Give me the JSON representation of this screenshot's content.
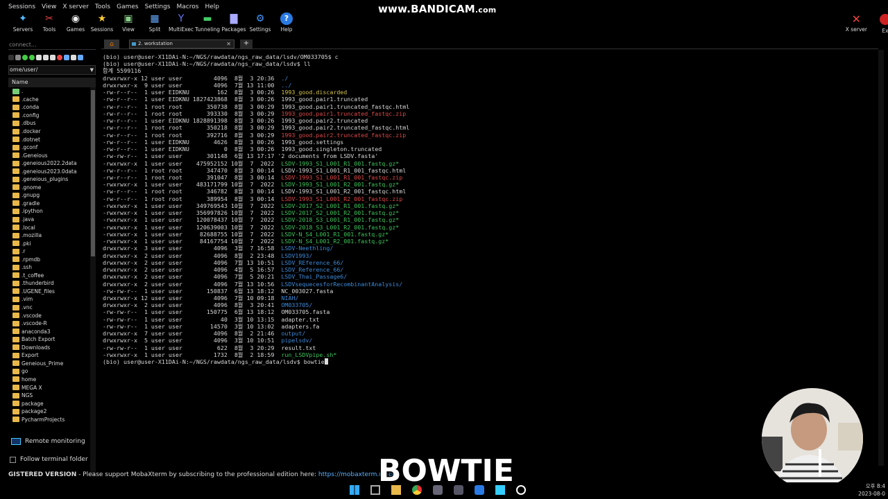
{
  "menu": [
    "Sessions",
    "View",
    "X server",
    "Tools",
    "Games",
    "Settings",
    "Macros",
    "Help"
  ],
  "toolbar": [
    {
      "label": "Servers",
      "icon": "servers-icon"
    },
    {
      "label": "Tools",
      "icon": "tools-icon"
    },
    {
      "label": "Games",
      "icon": "games-icon"
    },
    {
      "label": "Sessions",
      "icon": "sessions-icon"
    },
    {
      "label": "View",
      "icon": "view-icon"
    },
    {
      "label": "Split",
      "icon": "split-icon"
    },
    {
      "label": "MultiExec",
      "icon": "multiexec-icon"
    },
    {
      "label": "Tunneling",
      "icon": "tunneling-icon"
    },
    {
      "label": "Packages",
      "icon": "packages-icon"
    },
    {
      "label": "Settings",
      "icon": "settings-icon"
    },
    {
      "label": "Help",
      "icon": "help-icon"
    }
  ],
  "toolbar_right": {
    "xserver": "X server",
    "exit": "Ex"
  },
  "watermark": {
    "main": "www.BANDICAM",
    "suffix": ".com"
  },
  "sidebar": {
    "search_placeholder": "connect...",
    "path": "ome/user/",
    "header": "Name",
    "items": [
      ".",
      ".cache",
      ".conda",
      ".config",
      ".dbus",
      ".docker",
      ".dotnet",
      ".gconf",
      ".Geneious",
      ".geneious2022.2data",
      ".geneious2023.0data",
      ".geneious_plugins",
      ".gnome",
      ".gnupg",
      ".gradle",
      ".ipython",
      ".java",
      ".local",
      ".mozilla",
      ".pki",
      ".r",
      ".rpmdb",
      ".ssh",
      ".t_coffee",
      ".thunderbird",
      ".UGENE_files",
      ".vim",
      ".vnc",
      ".vscode",
      ".vscode-R",
      "anaconda3",
      "Batch Export",
      "Downloads",
      "Export",
      "Geneious_Prime",
      "go",
      "home",
      "MEGA X",
      "NGS",
      "package",
      "package2",
      "PycharmProjects"
    ],
    "remote_monitoring": "Remote monitoring",
    "follow_folder": "Follow terminal folder"
  },
  "tabs": {
    "active": "2. workstation"
  },
  "terminal": {
    "lines": [
      {
        "t": "(bio) user@user-X11DAi-N:~/NGS/rawdata/ngs_raw_data/lsdv/OM033705$ c",
        "c": ""
      },
      {
        "t": "(bio) user@user-X11DAi-N:~/NGS/rawdata/ngs_raw_data/lsdv$ ll",
        "c": ""
      },
      {
        "t": "합계 5599116",
        "c": ""
      },
      {
        "p": "drwxrwxr-x 12 user user         4096  8월  3 20:36  ",
        "n": "./",
        "c": "c-blue"
      },
      {
        "p": "drwxrwxr-x  9 user user         4096  7월 13 11:00  ",
        "n": "../",
        "c": "c-blue"
      },
      {
        "p": "-rw-r--r--  1 user EIDKNU        162  8월  3 00:26  ",
        "n": "1993_good.discarded",
        "c": "",
        "hl": ".discarded"
      },
      {
        "p": "-rw-r--r--  1 user EIDKNU 1827423868  8월  3 00:26  ",
        "n": "1993_good.pair1.truncated",
        "c": ""
      },
      {
        "p": "-rw-r--r--  1 root root       350738  8월  3 00:29  ",
        "n": "1993_good.pair1.truncated_fastqc.html",
        "c": ""
      },
      {
        "p": "-rw-r--r--  1 root root       393330  8월  3 00:29  ",
        "n": "1993_good.pair1.truncated_fastqc.zip",
        "c": "c-red"
      },
      {
        "p": "-rw-r--r--  1 user EIDKNU 1828891398  8월  3 00:26  ",
        "n": "1993_good.pair2.truncated",
        "c": ""
      },
      {
        "p": "-rw-r--r--  1 root root       350218  8월  3 00:29  ",
        "n": "1993_good.pair2.truncated_fastqc.html",
        "c": ""
      },
      {
        "p": "-rw-r--r--  1 root root       392716  8월  3 00:29  ",
        "n": "1993_good.pair2.truncated_fastqc.zip",
        "c": "c-red"
      },
      {
        "p": "-rw-r--r--  1 user EIDKNU       4626  8월  3 00:26  ",
        "n": "1993_good.settings",
        "c": ""
      },
      {
        "p": "-rw-r--r--  1 user EIDKNU          0  8월  3 00:26  ",
        "n": "1993_good.singleton.truncated",
        "c": ""
      },
      {
        "p": "-rw-rw-r--  1 user user       301148  6월 13 17:17 ",
        "n": "'2 documents from LSDV.fasta'",
        "c": ""
      },
      {
        "p": "-rwxrwxr-x  1 user user    475952152 10월  7  2022  ",
        "n": "LSDV-1993_S1_L001_R1_001.fastq.gz*",
        "c": "c-green"
      },
      {
        "p": "-rw-r--r--  1 root root       347470  8월  3 00:14  ",
        "n": "LSDV-1993_S1_L001_R1_001_fastqc.html",
        "c": ""
      },
      {
        "p": "-rw-r--r--  1 root root       391047  8월  3 00:14  ",
        "n": "LSDV-1993_S1_L001_R1_001_fastqc.zip",
        "c": "c-red"
      },
      {
        "p": "-rwxrwxr-x  1 user user    483171799 10월  7  2022  ",
        "n": "LSDV-1993_S1_L001_R2_001.fastq.gz*",
        "c": "c-green"
      },
      {
        "p": "-rw-r--r--  1 root root       346782  8월  3 00:14  ",
        "n": "LSDV-1993_S1_L001_R2_001_fastqc.html",
        "c": ""
      },
      {
        "p": "-rw-r--r--  1 root root       389954  8월  3 00:14  ",
        "n": "LSDV-1993_S1_L001_R2_001_fastqc.zip",
        "c": "c-red"
      },
      {
        "p": "-rwxrwxr-x  1 user user    349769543 10월  7  2022  ",
        "n": "LSDV-2017_S2_L001_R1_001.fastq.gz*",
        "c": "c-green"
      },
      {
        "p": "-rwxrwxr-x  1 user user    356997826 10월  7  2022  ",
        "n": "LSDV-2017_S2_L001_R2_001.fastq.gz*",
        "c": "c-green"
      },
      {
        "p": "-rwxrwxr-x  1 user user    120078437 10월  7  2022  ",
        "n": "LSDV-2018_S3_L001_R1_001.fastq.gz*",
        "c": "c-green"
      },
      {
        "p": "-rwxrwxr-x  1 user user    120639003 10월  7  2022  ",
        "n": "LSDV-2018_S3_L001_R2_001.fastq.gz*",
        "c": "c-green"
      },
      {
        "p": "-rwxrwxr-x  1 user user     82688755 10월  7  2022  ",
        "n": "LSDV-N_S4_L001_R1_001.fastq.gz*",
        "c": "c-green"
      },
      {
        "p": "-rwxrwxr-x  1 user user     84167754 10월  7  2022  ",
        "n": "LSDV-N_S4_L001_R2_001.fastq.gz*",
        "c": "c-green"
      },
      {
        "p": "drwxrwxr-x  3 user user         4096  3월  7 16:58  ",
        "n": "LSDV-Neethling/",
        "c": "c-blue"
      },
      {
        "p": "drwxrwxr-x  2 user user         4096  8월  2 23:48  ",
        "n": "LSDV1993/",
        "c": "c-blue"
      },
      {
        "p": "drwxrwxr-x  2 user user         4096  7월 13 10:51  ",
        "n": "LSDV_REference_66/",
        "c": "c-blue"
      },
      {
        "p": "drwxrwxr-x  2 user user         4096  4월  5 16:57  ",
        "n": "LSDV_Reference_66/",
        "c": "c-blue"
      },
      {
        "p": "drwxrwxr-x  2 user user         4096  7월  5 20:21  ",
        "n": "LSDV_Thai_Passage6/",
        "c": "c-blue"
      },
      {
        "p": "drwxrwxr-x  2 user user         4096  7월 13 10:56  ",
        "n": "LSDVsequecesforRecombinantAnalysis/",
        "c": "c-blue"
      },
      {
        "p": "-rw-rw-r--  1 user user       150837  6월 13 18:12  ",
        "n": "NC_003027.fasta",
        "c": ""
      },
      {
        "p": "drwxrwxr-x 12 user user         4096  7월 10 09:18  ",
        "n": "NIAH/",
        "c": "c-blue"
      },
      {
        "p": "drwxrwxr-x  2 user user         4096  8월  3 20:41  ",
        "n": "OM033705/",
        "c": "c-blue"
      },
      {
        "p": "-rw-rw-r--  1 user user       150775  6월 13 18:12  ",
        "n": "OM033705.fasta",
        "c": ""
      },
      {
        "p": "-rw-rw-r--  1 user user           40  3월 10 13:15  ",
        "n": "adapter.txt",
        "c": ""
      },
      {
        "p": "-rw-rw-r--  1 user user        14570  3월 10 13:02  ",
        "n": "adapters.fa",
        "c": ""
      },
      {
        "p": "drwxrwxr-x  7 user user         4096  8월  2 21:46  ",
        "n": "output/",
        "c": "c-blue"
      },
      {
        "p": "drwxrwxr-x  5 user user         4096  3월 10 10:51  ",
        "n": "pipelsdv/",
        "c": "c-blue"
      },
      {
        "p": "-rw-rw-r--  1 user user          622  8월  3 20:29  ",
        "n": "result.txt",
        "c": ""
      },
      {
        "p": "-rwxrwxr-x  1 user user         1732  8월  2 18:59  ",
        "n": "run_LSDVpipe.sh*",
        "c": "c-green"
      }
    ],
    "prompt": "(bio) user@user-X11DAi-N:~/NGS/rawdata/ngs_raw_data/lsdv$ ",
    "command": "bowtie"
  },
  "statusbar": {
    "registered": "GISTERED VERSION",
    "message": "  -  Please support MobaXterm by subscribing to the professional edition here: ",
    "link": "https://mobaxterm.mobat"
  },
  "caption": "BOWTIE",
  "clock": {
    "time": "오후 8:4",
    "date": "2023-08-0"
  },
  "taskbar_icons": [
    "windows-start-icon",
    "task-view-icon",
    "file-explorer-icon",
    "chrome-icon",
    "app-icon",
    "mobaxterm-icon",
    "vscode-icon",
    "notepad-icon",
    "bandicam-record-icon"
  ]
}
